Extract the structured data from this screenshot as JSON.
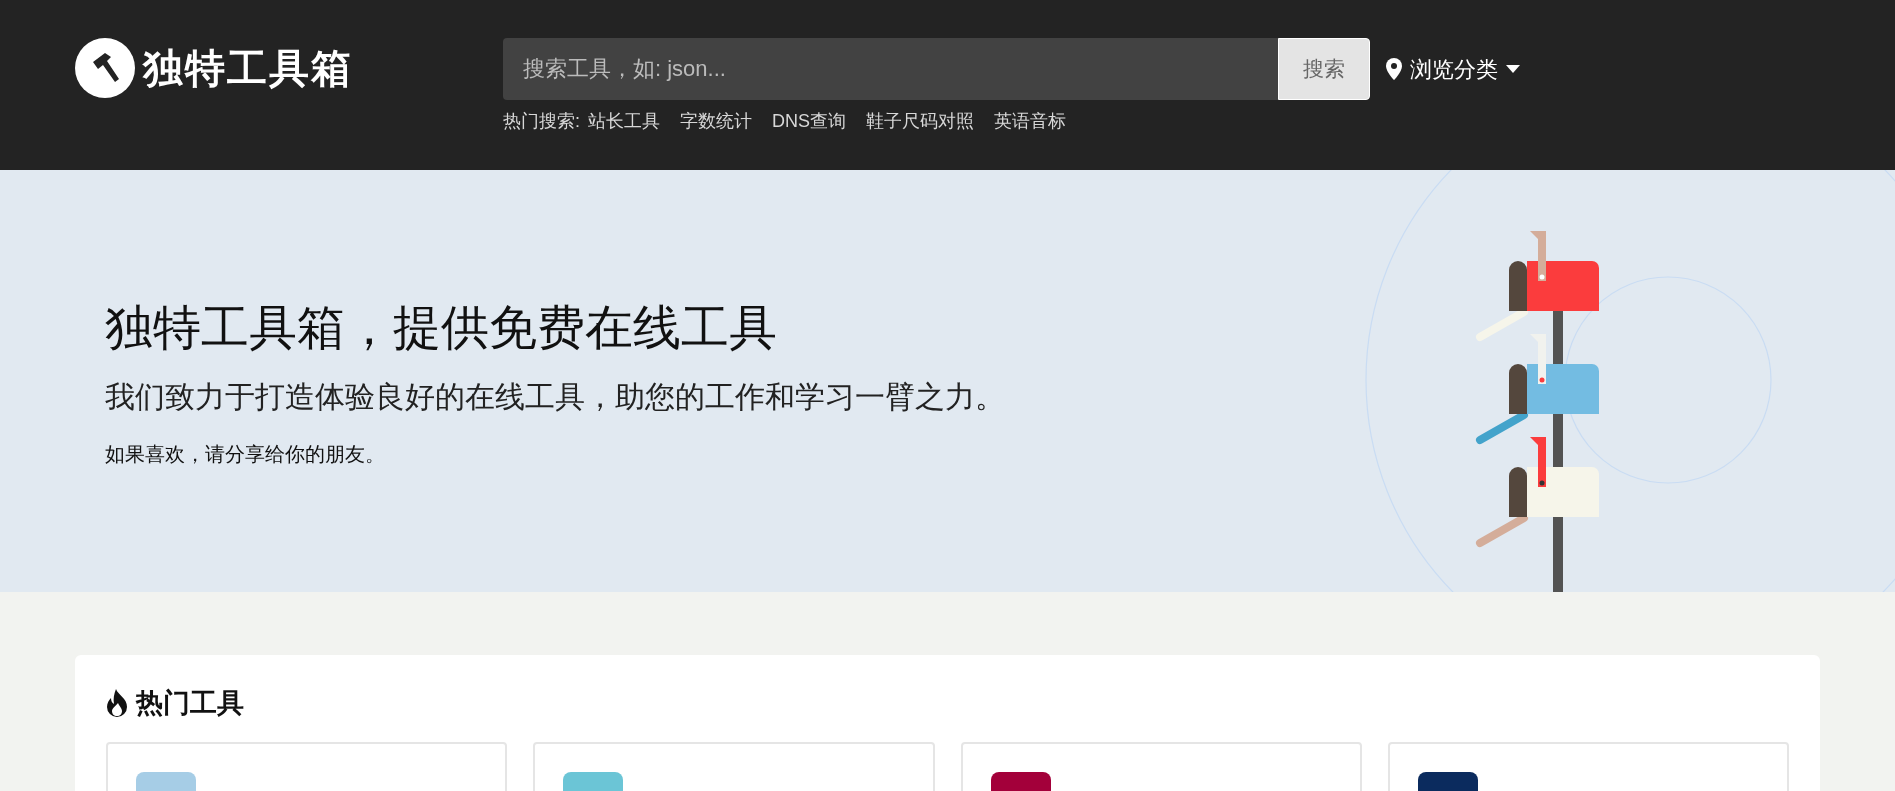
{
  "header": {
    "logo_text": "独特工具箱",
    "search": {
      "placeholder": "搜索工具，如: json..."
    },
    "search_button": "搜索",
    "browse_menu": "浏览分类",
    "hot_search_label": "热门搜索:",
    "hot_searches": [
      "站长工具",
      "字数统计",
      "DNS查询",
      "鞋子尺码对照",
      "英语音标"
    ]
  },
  "hero": {
    "title": "独特工具箱，提供免费在线工具",
    "subtitle": "我们致力于打造体验良好的在线工具，助您的工作和学习一臂之力。",
    "note": "如果喜欢，请分享给你的朋友。"
  },
  "hot_tools": {
    "title": "热门工具",
    "tools": [
      {
        "color": "#a6cde6"
      },
      {
        "color": "#6bc5d6"
      },
      {
        "color": "#a3003a"
      },
      {
        "color": "#0b2b5e"
      }
    ]
  }
}
